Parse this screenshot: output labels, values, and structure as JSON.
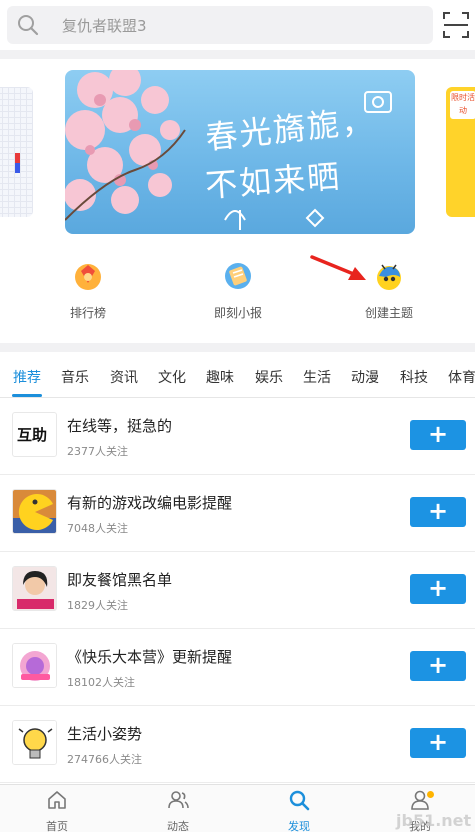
{
  "search": {
    "placeholder": "复仇者联盟3"
  },
  "banner": {
    "line1": "春光旖旎，",
    "line2": "不如来晒"
  },
  "side_card": {
    "tag": "限时活动"
  },
  "shortcuts": [
    {
      "label": "排行榜",
      "icon": "ranking-icon"
    },
    {
      "label": "即刻小报",
      "icon": "newspaper-icon"
    },
    {
      "label": "创建主题",
      "icon": "create-topic-icon"
    }
  ],
  "tabs": [
    "推荐",
    "音乐",
    "资讯",
    "文化",
    "趣味",
    "娱乐",
    "生活",
    "动漫",
    "科技",
    "体育"
  ],
  "active_tab": "推荐",
  "topics": [
    {
      "title": "在线等，挺急的",
      "followers": "2377人关注",
      "thumb_text": "互助"
    },
    {
      "title": "有新的游戏改编电影提醒",
      "followers": "7048人关注",
      "thumb_text": ""
    },
    {
      "title": "即友餐馆黑名单",
      "followers": "1829人关注",
      "thumb_text": ""
    },
    {
      "title": "《快乐大本营》更新提醒",
      "followers": "18102人关注",
      "thumb_text": ""
    },
    {
      "title": "生活小姿势",
      "followers": "274766人关注",
      "thumb_text": ""
    }
  ],
  "add_label": "+",
  "nav": [
    {
      "label": "首页",
      "icon": "home-icon"
    },
    {
      "label": "动态",
      "icon": "people-icon"
    },
    {
      "label": "发现",
      "icon": "discover-search-icon"
    },
    {
      "label": "我的",
      "icon": "profile-icon"
    }
  ],
  "watermark": "jb51.net",
  "colors": {
    "accent": "#1c8fdb",
    "button": "#1c93e3",
    "badge": "#ffb400"
  }
}
